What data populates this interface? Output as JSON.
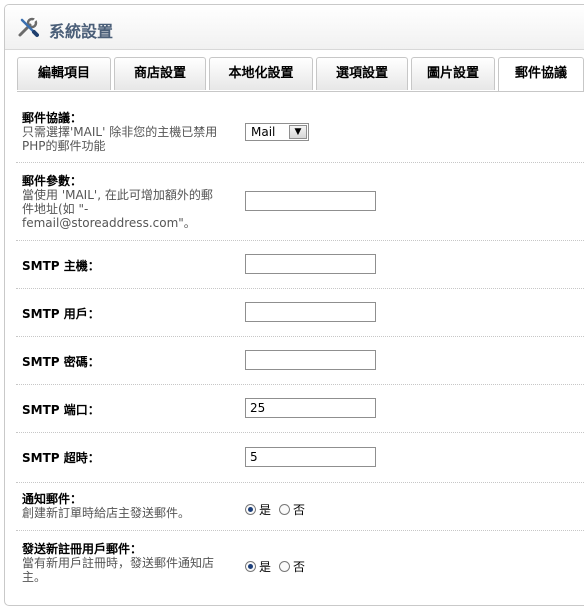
{
  "header": {
    "title": "系統設置",
    "icon": "wrench-screwdriver-icon"
  },
  "tabs": [
    {
      "label": "編輯項目"
    },
    {
      "label": "商店設置"
    },
    {
      "label": "本地化設置"
    },
    {
      "label": "選項設置"
    },
    {
      "label": "圖片設置"
    },
    {
      "label": "郵件協議",
      "active": true
    }
  ],
  "form": {
    "mail_protocol": {
      "label": "郵件協議：",
      "help_line1": "只需選擇'MAIL' 除非您的主機已禁用",
      "help_line2": "PHP的郵件功能",
      "selected": "Mail"
    },
    "mail_parameter": {
      "label": "郵件參數：",
      "help_line1": "當使用 'MAIL', 在此可增加額外的郵",
      "help_line2": "件地址(如 \"-",
      "help_line3": "femail@storeaddress.com\"。",
      "value": ""
    },
    "smtp_host": {
      "label": "SMTP 主機：",
      "value": ""
    },
    "smtp_user": {
      "label": "SMTP 用戶：",
      "value": ""
    },
    "smtp_password": {
      "label": "SMTP 密碼：",
      "value": ""
    },
    "smtp_port": {
      "label": "SMTP 端口：",
      "value": "25"
    },
    "smtp_timeout": {
      "label": "SMTP 超時：",
      "value": "5"
    },
    "alert_mail": {
      "label": "通知郵件：",
      "help_line1": "創建新訂單時給店主發送郵件。",
      "yes_label": "是",
      "no_label": "否",
      "selected": "是"
    },
    "account_mail": {
      "label": "發送新註冊用戶郵件：",
      "help_line1": "當有新用戶註冊時，發送郵件通知店",
      "help_line2": "主。",
      "yes_label": "是",
      "no_label": "否",
      "selected": "是"
    }
  }
}
